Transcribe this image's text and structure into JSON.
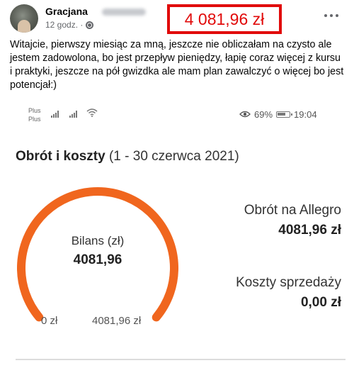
{
  "post": {
    "author": "Gracjana",
    "time": "12 godz. ·",
    "more_label": "...",
    "text": "Witajcie, pierwszy miesiąc za mną, jeszcze nie obliczałam na czysto ale jestem zadowolona, bo jest przepływ pieniędzy, łapię coraz więcej z kursu i praktyki, jeszcze na pół gwizdka ale mam plan zawalczyć o więcej bo jest potencjał:)"
  },
  "highlight": {
    "amount": "4 081,96 zł",
    "color": "#e10a0a"
  },
  "phone_status": {
    "carrier_line1": "Plus",
    "carrier_line2": "Plus",
    "battery": "69%",
    "time": "19:04"
  },
  "report": {
    "title": "Obrót i koszty",
    "range": "(1 - 30 czerwca 2021)",
    "balance_label": "Bilans (zł)",
    "balance_value": "4081,96",
    "gauge_min": "0 zł",
    "gauge_max": "4081,96 zł",
    "gauge_fill_fraction": 1.0,
    "gauge_color": "#f0661e",
    "turnover_label": "Obrót na Allegro",
    "turnover_value": "4081,96 zł",
    "costs_label": "Koszty sprzedaży",
    "costs_value": "0,00 zł"
  },
  "icons": [
    "globe-icon",
    "more-options-icon",
    "signal-icon",
    "wifi-icon",
    "eye-icon",
    "battery-icon"
  ]
}
